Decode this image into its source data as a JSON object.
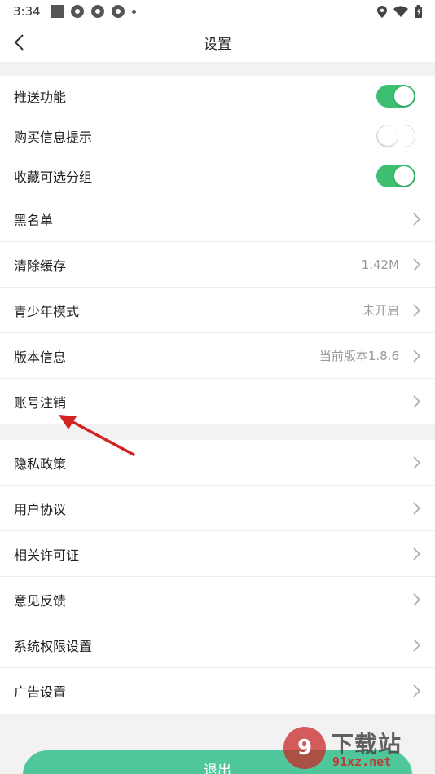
{
  "status_bar": {
    "time": "3:34"
  },
  "navbar": {
    "title": "设置"
  },
  "toggles": [
    {
      "label": "推送功能",
      "on": true
    },
    {
      "label": "购买信息提示",
      "on": false
    },
    {
      "label": "收藏可选分组",
      "on": true
    }
  ],
  "group1": [
    {
      "label": "黑名单",
      "value": ""
    },
    {
      "label": "清除缓存",
      "value": "1.42M"
    },
    {
      "label": "青少年模式",
      "value": "未开启"
    },
    {
      "label": "版本信息",
      "value": "当前版本1.8.6"
    },
    {
      "label": "账号注销",
      "value": ""
    }
  ],
  "group2": [
    {
      "label": "隐私政策"
    },
    {
      "label": "用户协议"
    },
    {
      "label": "相关许可证"
    },
    {
      "label": "意见反馈"
    },
    {
      "label": "系统权限设置"
    },
    {
      "label": "广告设置"
    }
  ],
  "logout_label": "退出",
  "watermark": {
    "badge": "9",
    "title": "下载站",
    "url": "91xz.net"
  },
  "colors": {
    "accent_green": "#3dbf72",
    "annotation_arrow": "#d22222"
  }
}
